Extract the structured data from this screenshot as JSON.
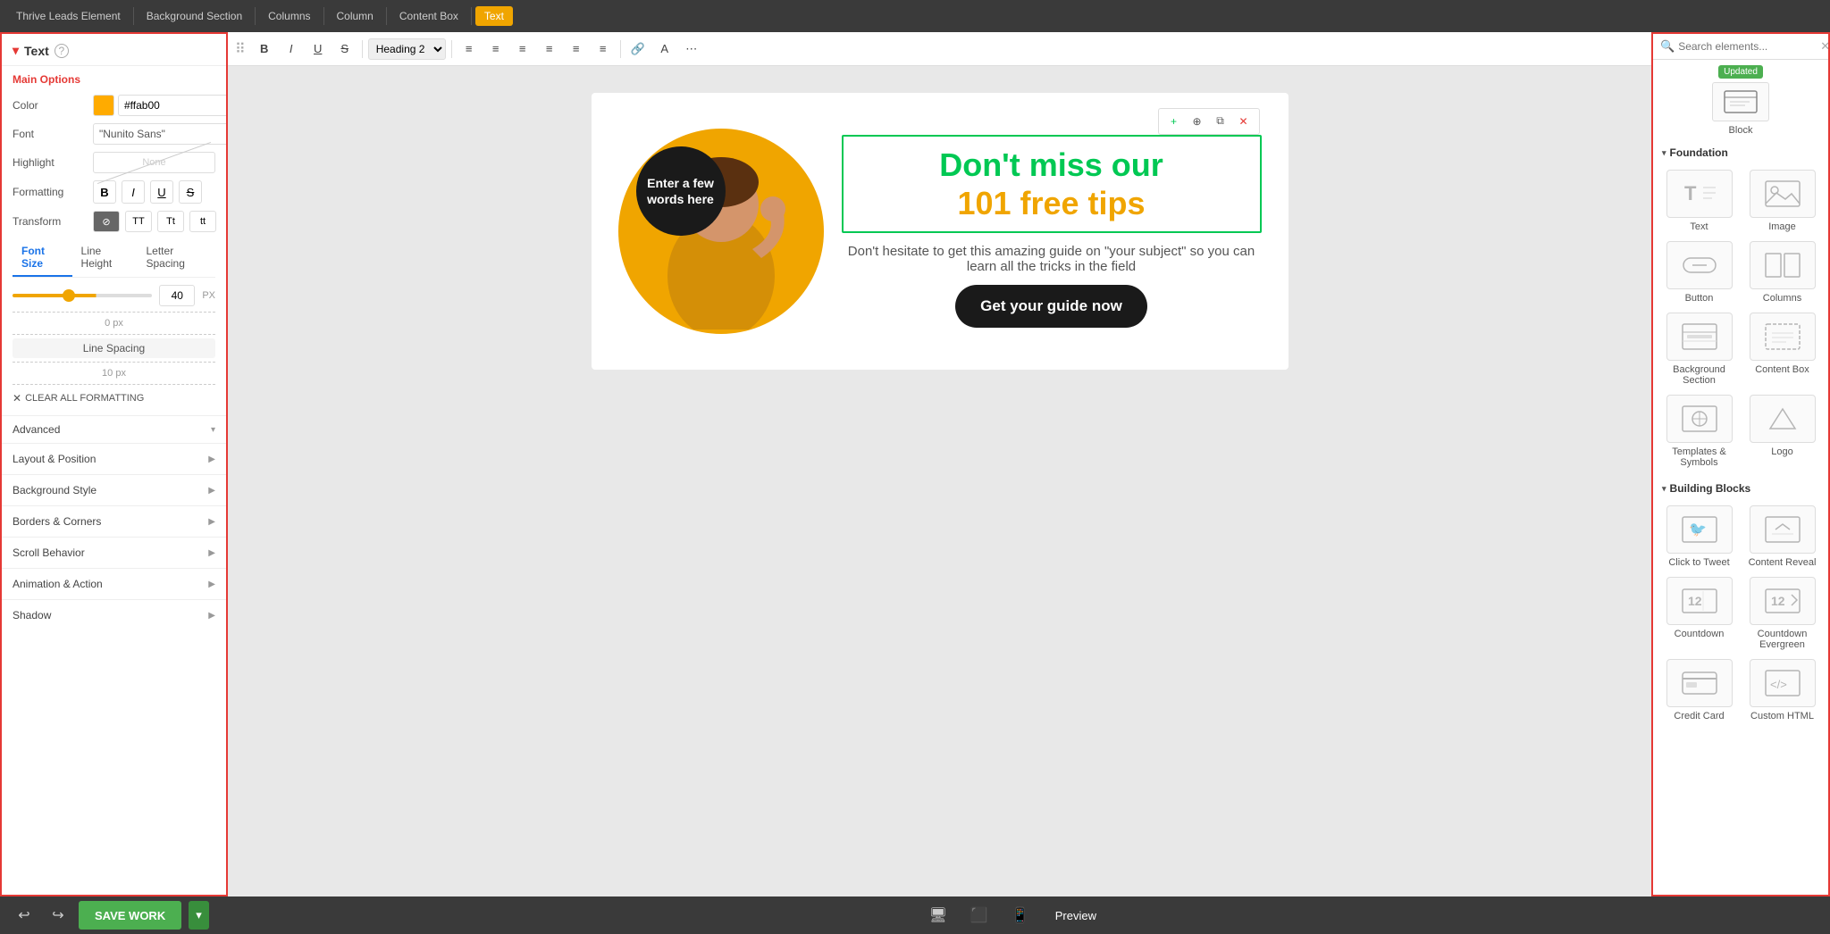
{
  "topbar": {
    "items": [
      {
        "label": "Thrive Leads Element",
        "active": false
      },
      {
        "label": "Background Section",
        "active": false
      },
      {
        "label": "Columns",
        "active": false
      },
      {
        "label": "Column",
        "active": false
      },
      {
        "label": "Content Box",
        "active": false
      },
      {
        "label": "Text",
        "active": true
      }
    ]
  },
  "toolbar": {
    "heading_select": "Heading 2",
    "bold": "B",
    "italic": "I",
    "underline": "U",
    "strikethrough": "S"
  },
  "left_panel": {
    "title": "Text",
    "help_icon": "?",
    "sections": {
      "main_options": "Main Options",
      "color_label": "Color",
      "color_value": "#ffab00",
      "font_label": "Font",
      "font_value": "\"Nunito Sans\"",
      "highlight_label": "Highlight",
      "highlight_value": "None",
      "formatting_label": "Formatting",
      "transform_label": "Transform",
      "font_size_tab": "Font Size",
      "line_height_tab": "Line Height",
      "letter_spacing_tab": "Letter Spacing",
      "font_size_value": "40",
      "font_size_unit": "PX",
      "spacing_top": "0 px",
      "line_spacing_label": "Line Spacing",
      "spacing_bottom": "10 px",
      "clear_formatting": "CLEAR ALL FORMATTING",
      "advanced": "Advanced"
    },
    "accordions": [
      {
        "label": "Layout & Position"
      },
      {
        "label": "Background Style"
      },
      {
        "label": "Borders & Corners"
      },
      {
        "label": "Scroll Behavior"
      },
      {
        "label": "Animation & Action"
      },
      {
        "label": "Shadow"
      }
    ]
  },
  "canvas": {
    "circle_text": "Enter a few words here",
    "headline_line1": "Don't miss our",
    "headline_line2": "101 free tips",
    "subtext": "Don't hesitate to get this amazing guide on \"your subject\" so you can learn all the tricks in the field",
    "cta_button": "Get your guide now"
  },
  "bottom_bar": {
    "save_label": "SAVE WORK",
    "preview_label": "Preview"
  },
  "right_panel": {
    "search_placeholder": "Search elements...",
    "updated_badge": "Updated",
    "block_label": "Block",
    "sections": [
      {
        "title": "Foundation",
        "elements": [
          {
            "label": "Text",
            "icon": "text"
          },
          {
            "label": "Image",
            "icon": "image"
          },
          {
            "label": "Button",
            "icon": "button"
          },
          {
            "label": "Columns",
            "icon": "columns"
          },
          {
            "label": "Background Section",
            "icon": "bg-section"
          },
          {
            "label": "Content Box",
            "icon": "content-box"
          },
          {
            "label": "Templates & Symbols",
            "icon": "templates"
          },
          {
            "label": "Logo",
            "icon": "logo"
          }
        ]
      },
      {
        "title": "Building Blocks",
        "elements": [
          {
            "label": "Click to Tweet",
            "icon": "click-tweet"
          },
          {
            "label": "Content Reveal",
            "icon": "content-reveal"
          },
          {
            "label": "Countdown",
            "icon": "countdown"
          },
          {
            "label": "Countdown Evergreen",
            "icon": "countdown-evergreen"
          },
          {
            "label": "Credit Card",
            "icon": "credit-card"
          },
          {
            "label": "Custom HTML",
            "icon": "custom-html"
          }
        ]
      }
    ]
  }
}
